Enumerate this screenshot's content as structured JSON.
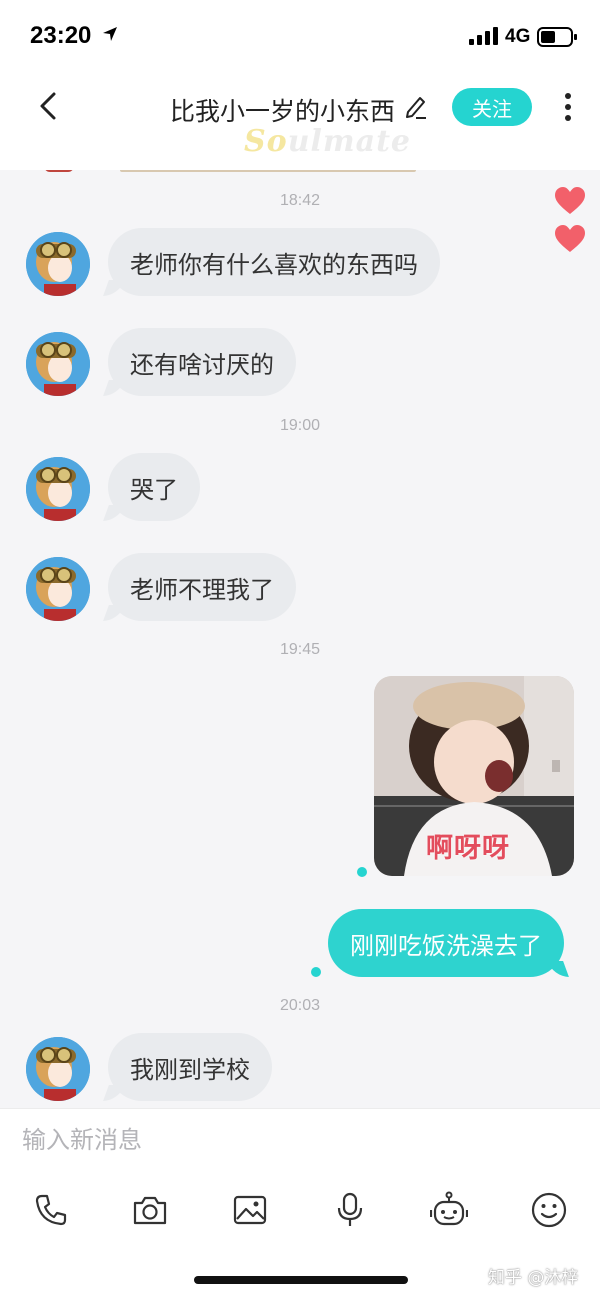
{
  "status_bar": {
    "time": "23:20",
    "network": "4G"
  },
  "header": {
    "title": "比我小一岁的小东西",
    "follow_label": "关注",
    "logo_text_highlight": "So",
    "logo_text_rest": "ulmate"
  },
  "messages": [
    {
      "type": "timestamp",
      "text": "18:42"
    },
    {
      "type": "incoming",
      "text": "老师你有什么喜欢的东西吗"
    },
    {
      "type": "incoming",
      "text": "还有啥讨厌的"
    },
    {
      "type": "timestamp",
      "text": "19:00"
    },
    {
      "type": "incoming",
      "text": "哭了"
    },
    {
      "type": "incoming",
      "text": "老师不理我了"
    },
    {
      "type": "timestamp",
      "text": "19:45"
    },
    {
      "type": "outgoing_sticker",
      "caption": "啊呀呀"
    },
    {
      "type": "outgoing",
      "text": "刚刚吃饭洗澡去了"
    },
    {
      "type": "timestamp",
      "text": "20:03"
    },
    {
      "type": "incoming",
      "text": "我刚到学校"
    }
  ],
  "input": {
    "placeholder": "输入新消息"
  },
  "toolbar": {
    "icons": [
      "phone-icon",
      "camera-icon",
      "image-icon",
      "microphone-icon",
      "robot-icon",
      "smiley-icon"
    ]
  },
  "watermark": "知乎 @沐梓",
  "colors": {
    "accent": "#2ed3cf",
    "incoming_bubble": "#e9ebee",
    "heart": "#f2606a"
  }
}
